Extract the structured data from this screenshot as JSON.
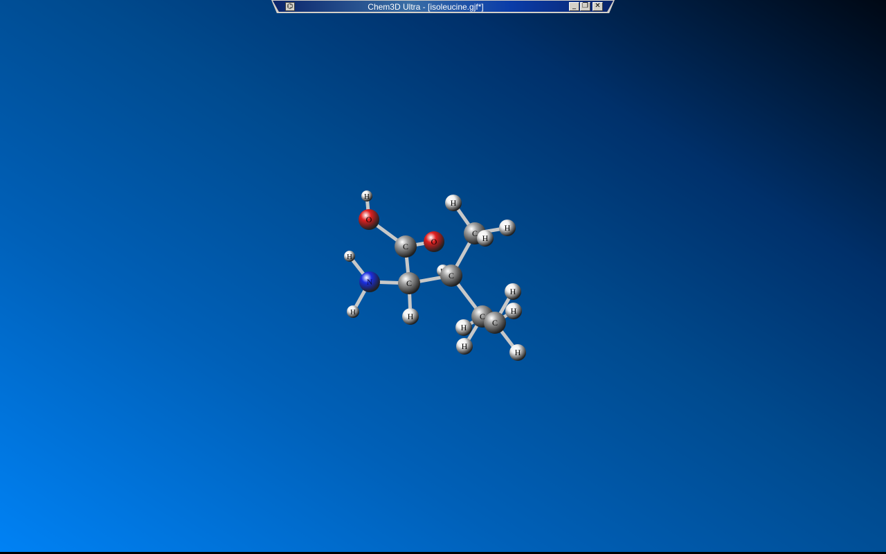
{
  "window": {
    "title": "Chem3D Ultra - [isoleucine.gjf*]",
    "controls": {
      "minimize": "_",
      "restore": "❐",
      "close": "✕"
    }
  },
  "colors": {
    "carbon": "#a0a0a0",
    "oxygen": "#e02020",
    "nitrogen": "#1a2ee0",
    "hydrogen": "#f0f0f0",
    "bond": "#c8c8c8"
  },
  "molecule": {
    "name": "isoleucine",
    "atoms": [
      {
        "id": "C1",
        "el": "C",
        "label": "C"
      },
      {
        "id": "O1",
        "el": "O",
        "label": "O"
      },
      {
        "id": "O2",
        "el": "O",
        "label": "O"
      },
      {
        "id": "H1",
        "el": "H",
        "label": "H"
      },
      {
        "id": "Ca",
        "el": "C",
        "label": "C"
      },
      {
        "id": "N",
        "el": "N",
        "label": "N"
      },
      {
        "id": "H2",
        "el": "H",
        "label": "H"
      },
      {
        "id": "H3",
        "el": "H",
        "label": "H"
      },
      {
        "id": "H4",
        "el": "H",
        "label": "H"
      },
      {
        "id": "Cb",
        "el": "C",
        "label": "C"
      },
      {
        "id": "H5",
        "el": "H",
        "label": "H"
      },
      {
        "id": "Cg1",
        "el": "C",
        "label": "C"
      },
      {
        "id": "H6",
        "el": "H",
        "label": "H"
      },
      {
        "id": "H7",
        "el": "H",
        "label": "H"
      },
      {
        "id": "H8",
        "el": "H",
        "label": "H"
      },
      {
        "id": "Cg2",
        "el": "C",
        "label": "C"
      },
      {
        "id": "H9",
        "el": "H",
        "label": "H"
      },
      {
        "id": "H10",
        "el": "H",
        "label": "H"
      },
      {
        "id": "Cd",
        "el": "C",
        "label": "C"
      },
      {
        "id": "H11",
        "el": "H",
        "label": "H"
      },
      {
        "id": "H12",
        "el": "H",
        "label": "H"
      },
      {
        "id": "H13",
        "el": "H",
        "label": "H"
      }
    ],
    "bonds": [
      [
        "C1",
        "O1"
      ],
      [
        "C1",
        "O2"
      ],
      [
        "O2",
        "H1"
      ],
      [
        "C1",
        "Ca"
      ],
      [
        "Ca",
        "N"
      ],
      [
        "N",
        "H2"
      ],
      [
        "N",
        "H3"
      ],
      [
        "Ca",
        "H4"
      ],
      [
        "Ca",
        "Cb"
      ],
      [
        "Cb",
        "H5"
      ],
      [
        "Cb",
        "Cg1"
      ],
      [
        "Cg1",
        "H6"
      ],
      [
        "Cg1",
        "H7"
      ],
      [
        "Cg1",
        "H8"
      ],
      [
        "Cb",
        "Cg2"
      ],
      [
        "Cg2",
        "H9"
      ],
      [
        "Cg2",
        "H10"
      ],
      [
        "Cg2",
        "Cd"
      ],
      [
        "Cd",
        "H11"
      ],
      [
        "Cd",
        "H12"
      ],
      [
        "Cd",
        "H13"
      ]
    ]
  }
}
